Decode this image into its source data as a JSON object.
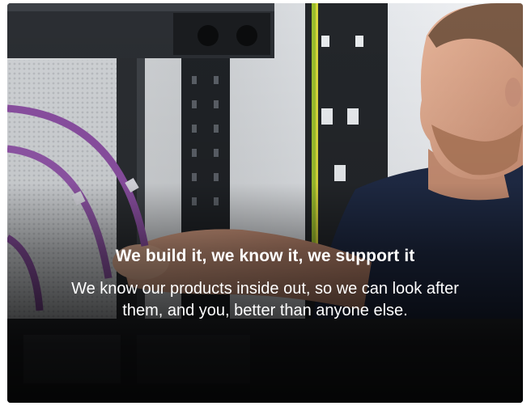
{
  "hero": {
    "headline": "We build it, we know it, we support it",
    "body": "We know our products inside out, so we can look after them, and you, better than anyone else.",
    "image": "photo of technician cabling a server rack"
  }
}
